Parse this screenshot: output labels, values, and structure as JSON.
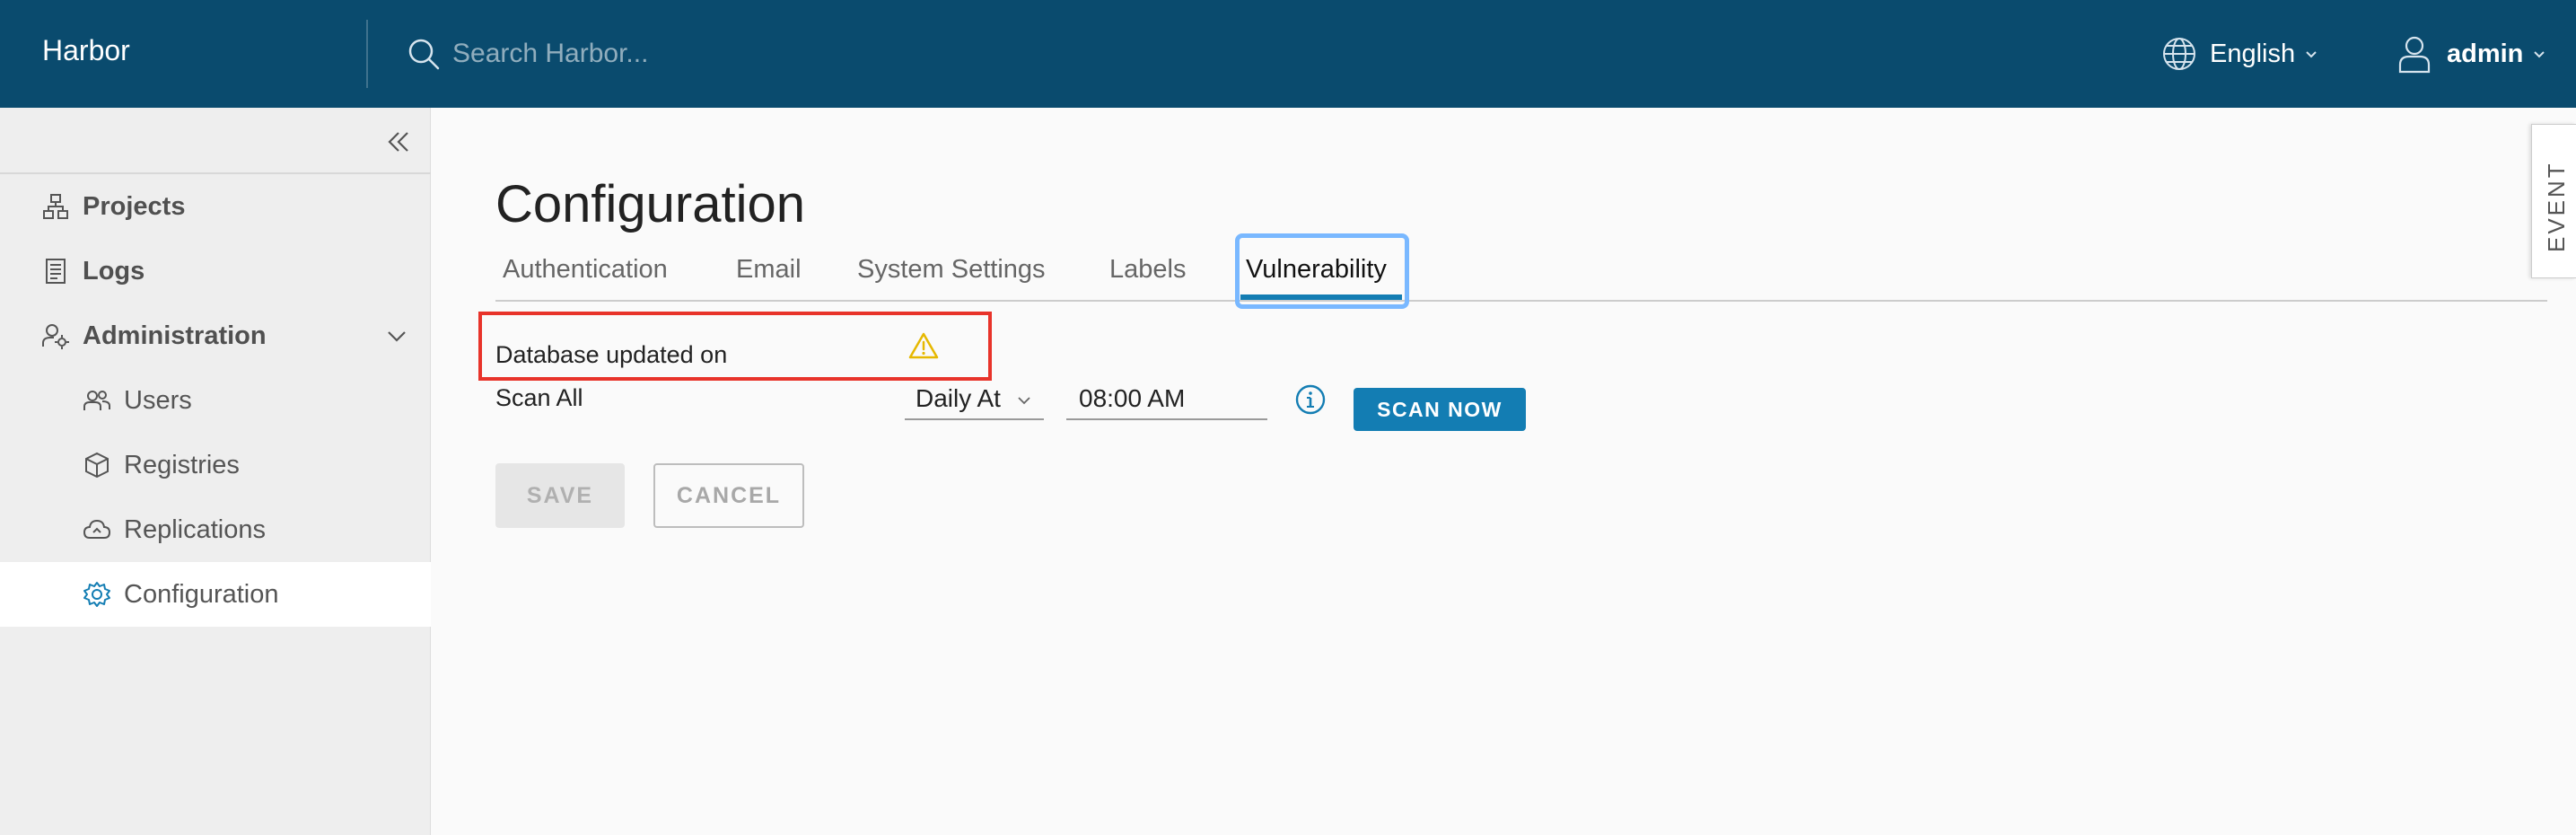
{
  "header": {
    "brand": "Harbor",
    "search_placeholder": "Search Harbor...",
    "language": "English",
    "user": "admin"
  },
  "sidebar": {
    "items": [
      {
        "label": "Projects",
        "icon": "projects-icon"
      },
      {
        "label": "Logs",
        "icon": "logs-icon"
      },
      {
        "label": "Administration",
        "icon": "administration-icon"
      },
      {
        "label": "Users",
        "icon": "users-icon"
      },
      {
        "label": "Registries",
        "icon": "registries-icon"
      },
      {
        "label": "Replications",
        "icon": "replications-icon"
      },
      {
        "label": "Configuration",
        "icon": "configuration-icon",
        "active": true
      }
    ]
  },
  "main": {
    "title": "Configuration",
    "tabs": [
      {
        "label": "Authentication"
      },
      {
        "label": "Email"
      },
      {
        "label": "System Settings"
      },
      {
        "label": "Labels"
      },
      {
        "label": "Vulnerability",
        "active": true
      }
    ],
    "database_updated_label": "Database updated on",
    "scan_all_label": "Scan All",
    "schedule_value": "Daily At",
    "time_value": "08:00 AM",
    "scan_now_label": "SCAN NOW",
    "save_label": "SAVE",
    "cancel_label": "CANCEL"
  },
  "event_tab_label": "EVENT",
  "colors": {
    "header_bg": "#0a4b6e",
    "accent": "#137db3",
    "highlight_border": "#e8332a",
    "warning": "#e6b800"
  }
}
